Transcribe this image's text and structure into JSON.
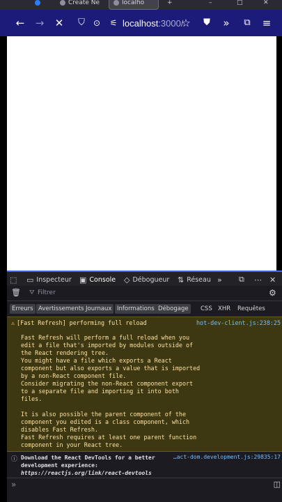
{
  "tabs": [
    {
      "label": "Create Ne"
    },
    {
      "label": "localho"
    }
  ],
  "toolbar": {
    "url_host": "localhost",
    "url_path": ":3000/"
  },
  "devtools": {
    "tabs": [
      "Inspecteur",
      "Console",
      "Débogueur",
      "Réseau"
    ],
    "filter_placeholder": "Filtrer",
    "levels": [
      "Erreurs",
      "Avertissements",
      "Journaux",
      "Informations",
      "Débogage"
    ],
    "request_types": [
      "CSS",
      "XHR",
      "Requêtes"
    ],
    "warning": {
      "title": "[Fast Refresh] performing full reload",
      "source": "hot-dev-client.js:238:25",
      "body": "Fast Refresh will perform a full reload when you\nedit a file that's imported by modules outside of\nthe React rendering tree.\nYou might have a file which exports a React\ncomponent but also exports a value that is imported\nby a non-React component file.\nConsider migrating the non-React component export\nto a separate file and importing it into both\nfiles.\n\nIt is also possible the parent component of the\ncomponent you edited is a class component, which\ndisables Fast Refresh.\nFast Refresh requires at least one parent function\ncomponent in your React tree."
    },
    "info": {
      "line1": "Download the React DevTools for a better",
      "line2": "development experience:",
      "link": "https://reactjs.org/link/react-devtools",
      "source": "…act-dom.development.js:29835:17"
    },
    "prompt": "»"
  },
  "colors": {
    "toolbar": "#1c1b7a",
    "devtools_bg": "#1c1b22",
    "warning_bg": "#3d3812",
    "link": "#75bfff"
  }
}
